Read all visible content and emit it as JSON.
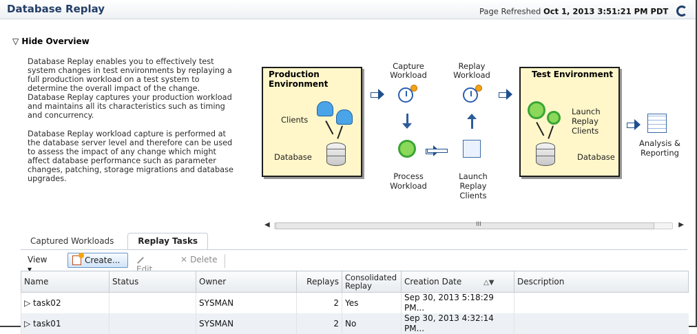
{
  "page": {
    "title": "Database Replay",
    "refresh_label": "Page Refreshed",
    "refresh_time": "Oct 1, 2013 3:51:21 PM PDT"
  },
  "overview": {
    "toggle_label": "Hide Overview",
    "paragraph1": "Database Replay enables you to effectively test system changes in test environments by replaying a full production workload on a test system to determine the overall impact of the change. Database Replay captures your production workload and maintains all its characteristics such as timing and concurrency.",
    "paragraph2": "Database Replay workload capture is performed at the database server level and therefore can be used to assess the impact of any change which might affect database performance such as parameter changes, patching, storage migrations and database upgrades."
  },
  "diagram": {
    "production_title_1": "Production",
    "production_title_2": "Environment",
    "clients": "Clients",
    "database": "Database",
    "capture_1": "Capture",
    "capture_2": "Workload",
    "replay_1": "Replay",
    "replay_2": "Workload",
    "process_1": "Process",
    "process_2": "Workload",
    "launch_1": "Launch",
    "launch_2": "Replay",
    "launch_3": "Clients",
    "test_title": "Test Environment",
    "test_launch_1": "Launch",
    "test_launch_2": "Replay",
    "test_launch_3": "Clients",
    "test_database": "Database",
    "analysis_1": "Analysis &",
    "analysis_2": "Reporting"
  },
  "scroll": {
    "grip": "III"
  },
  "tabs": [
    {
      "label": "Captured Workloads"
    },
    {
      "label": "Replay Tasks"
    }
  ],
  "toolbar": {
    "view": "View",
    "create": "Create...",
    "edit": "Edit...",
    "delete": "Delete"
  },
  "table": {
    "columns": [
      "Name",
      "Status",
      "Owner",
      "Replays",
      "Consolidated",
      "Replay",
      "Creation Date",
      "Description"
    ],
    "rows": [
      {
        "name": "task02",
        "status": "",
        "owner": "SYSMAN",
        "replays": "2",
        "consolidated": "Yes",
        "created": "Sep 30, 2013 5:18:29 PM...",
        "description": ""
      },
      {
        "name": "task01",
        "status": "",
        "owner": "SYSMAN",
        "replays": "2",
        "consolidated": "No",
        "created": "Sep 30, 2013 4:32:14 PM...",
        "description": ""
      }
    ]
  }
}
